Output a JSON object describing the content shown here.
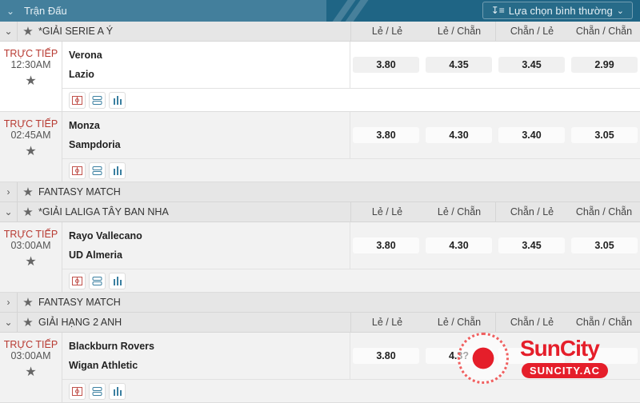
{
  "header": {
    "title": "Trận Đấu",
    "select_label": "Lựa chọn bình thường"
  },
  "odds_columns": [
    "Lẻ / Lẻ",
    "Lẻ / Chẵn",
    "Chẵn / Lẻ",
    "Chẵn / Chẵn"
  ],
  "leagues": [
    {
      "name": "*GIẢI SERIE A Ý",
      "expanded": true,
      "matches": [
        {
          "status": "TRỰC TIẾP",
          "time": "12:30AM",
          "home": "Verona",
          "away": "Lazio",
          "odds": [
            "3.80",
            "4.35",
            "3.45",
            "2.99"
          ]
        },
        {
          "status": "TRỰC TIẾP",
          "time": "02:45AM",
          "home": "Monza",
          "away": "Sampdoria",
          "odds": [
            "3.80",
            "4.30",
            "3.40",
            "3.05"
          ]
        }
      ]
    },
    {
      "name": "FANTASY MATCH",
      "expanded": false
    },
    {
      "name": "*GIẢI LALIGA TÂY BAN NHA",
      "expanded": true,
      "matches": [
        {
          "status": "TRỰC TIẾP",
          "time": "03:00AM",
          "home": "Rayo Vallecano",
          "away": "UD Almeria",
          "odds": [
            "3.80",
            "4.30",
            "3.45",
            "3.05"
          ]
        }
      ]
    },
    {
      "name": "FANTASY MATCH",
      "expanded": false
    },
    {
      "name": "GIẢI HẠNG 2 ANH",
      "expanded": true,
      "matches": [
        {
          "status": "TRỰC TIẾP",
          "time": "03:00AM",
          "home": "Blackburn Rovers",
          "away": "Wigan Athletic",
          "odds": [
            "3.80",
            "4.3?",
            "",
            ""
          ]
        }
      ]
    }
  ],
  "watermark": {
    "brand": "SunCity",
    "url": "SUNCITY.AC"
  },
  "colors": {
    "header_bg": "#437f9c",
    "header_bg_dark": "#1f6585",
    "live_red": "#b83a32",
    "brand_red": "#e51e2a"
  }
}
